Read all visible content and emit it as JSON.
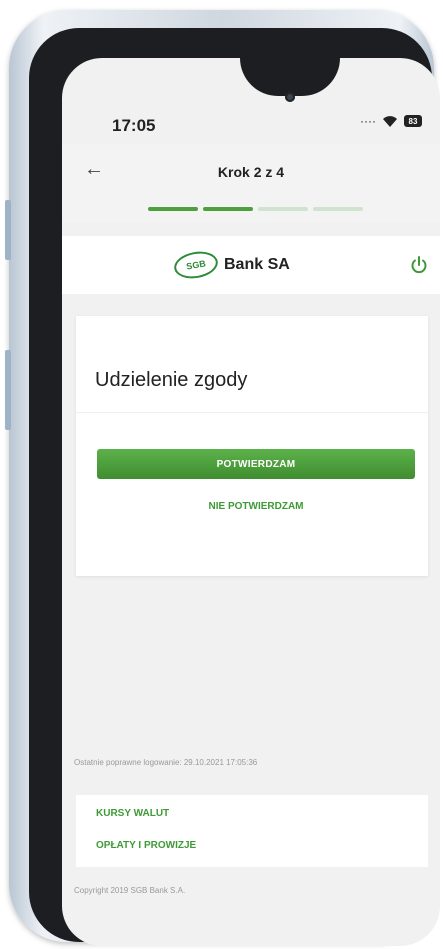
{
  "status": {
    "time": "17:05",
    "battery": "83"
  },
  "header": {
    "title": "Krok 2 z 4",
    "progress": {
      "current": 2,
      "total": 4
    }
  },
  "brand": {
    "logo_mark": "SGB",
    "name": "Bank SA",
    "color": "#2e8b3a"
  },
  "card": {
    "title": "Udzielenie zgody",
    "confirm_label": "POTWIERDZAM",
    "decline_label": "NIE POTWIERDZAM"
  },
  "footer": {
    "last_login": "Ostatnie poprawne logowanie: 29.10.2021 17:05:36",
    "links": [
      "KURSY WALUT",
      "OPŁATY I PROWIZJE"
    ],
    "copyright": "Copyright 2019 SGB Bank S.A."
  },
  "icons": {
    "back": "back-arrow-icon",
    "power": "power-icon",
    "wifi": "wifi-icon",
    "battery": "battery-icon"
  },
  "colors": {
    "accent": "#4e9f3d",
    "link": "#3e9a36",
    "background": "#f1f1f1"
  }
}
